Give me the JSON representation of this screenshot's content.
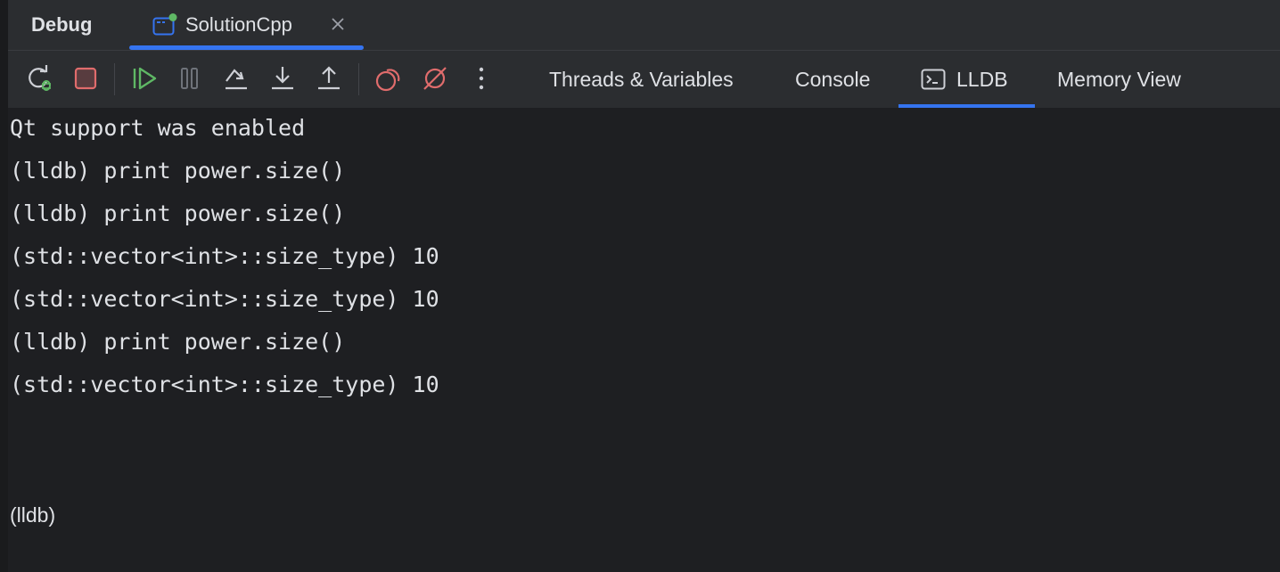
{
  "header": {
    "title": "Debug",
    "session_tab": {
      "label": "SolutionCpp"
    }
  },
  "toolbar": {
    "buttons": [
      {
        "name": "rerun-icon"
      },
      {
        "name": "stop-icon"
      },
      {
        "name": "resume-icon"
      },
      {
        "name": "pause-icon"
      },
      {
        "name": "step-over-icon"
      },
      {
        "name": "step-into-icon"
      },
      {
        "name": "step-out-icon"
      },
      {
        "name": "view-breakpoints-icon"
      },
      {
        "name": "mute-breakpoints-icon"
      },
      {
        "name": "more-options-icon"
      }
    ],
    "tabs": [
      {
        "label": "Threads & Variables"
      },
      {
        "label": "Console"
      },
      {
        "label": "LLDB",
        "active": true
      },
      {
        "label": "Memory View"
      }
    ]
  },
  "console": {
    "lines": [
      "Qt support was enabled",
      "(lldb) print power.size()",
      "(lldb) print power.size()",
      "(std::vector<int>::size_type) 10",
      "(std::vector<int>::size_type) 10",
      "(lldb) print power.size()",
      "(std::vector<int>::size_type) 10"
    ],
    "prompt": "(lldb)"
  },
  "colors": {
    "accent": "#3574f0",
    "run_green": "#5fb865",
    "stop_red": "#e06c6c",
    "status_dot": "#5fb865",
    "background": "#1e1f22",
    "toolbar": "#2b2d30"
  }
}
